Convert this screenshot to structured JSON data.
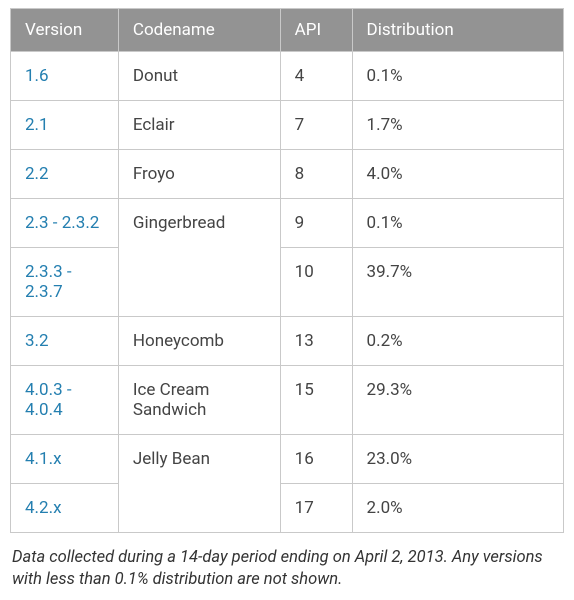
{
  "headers": {
    "version": "Version",
    "codename": "Codename",
    "api": "API",
    "distribution": "Distribution"
  },
  "rows": [
    {
      "version": "1.6",
      "codename": "Donut",
      "api": "4",
      "distribution": "0.1%"
    },
    {
      "version": "2.1",
      "codename": "Eclair",
      "api": "7",
      "distribution": "1.7%"
    },
    {
      "version": "2.2",
      "codename": "Froyo",
      "api": "8",
      "distribution": "4.0%"
    },
    {
      "version": "2.3 - 2.3.2",
      "codename": "Gingerbread",
      "api": "9",
      "distribution": "0.1%"
    },
    {
      "version": "2.3.3 - 2.3.7",
      "codename": "",
      "api": "10",
      "distribution": "39.7%"
    },
    {
      "version": "3.2",
      "codename": "Honeycomb",
      "api": "13",
      "distribution": "0.2%"
    },
    {
      "version": "4.0.3 - 4.0.4",
      "codename": "Ice Cream Sandwich",
      "api": "15",
      "distribution": "29.3%"
    },
    {
      "version": "4.1.x",
      "codename": "Jelly Bean",
      "api": "16",
      "distribution": "23.0%"
    },
    {
      "version": "4.2.x",
      "codename": "",
      "api": "17",
      "distribution": "2.0%"
    }
  ],
  "footnote": "Data collected during a 14-day period ending on April 2, 2013. Any versions with less than 0.1% distribution are not shown.",
  "chart_data": {
    "type": "table",
    "title": "Android Version Distribution",
    "columns": [
      "Version",
      "Codename",
      "API",
      "Distribution"
    ],
    "data": [
      [
        "1.6",
        "Donut",
        4,
        0.1
      ],
      [
        "2.1",
        "Eclair",
        7,
        1.7
      ],
      [
        "2.2",
        "Froyo",
        8,
        4.0
      ],
      [
        "2.3 - 2.3.2",
        "Gingerbread",
        9,
        0.1
      ],
      [
        "2.3.3 - 2.3.7",
        "Gingerbread",
        10,
        39.7
      ],
      [
        "3.2",
        "Honeycomb",
        13,
        0.2
      ],
      [
        "4.0.3 - 4.0.4",
        "Ice Cream Sandwich",
        15,
        29.3
      ],
      [
        "4.1.x",
        "Jelly Bean",
        16,
        23.0
      ],
      [
        "4.2.x",
        "Jelly Bean",
        17,
        2.0
      ]
    ],
    "distribution_unit": "percent"
  }
}
